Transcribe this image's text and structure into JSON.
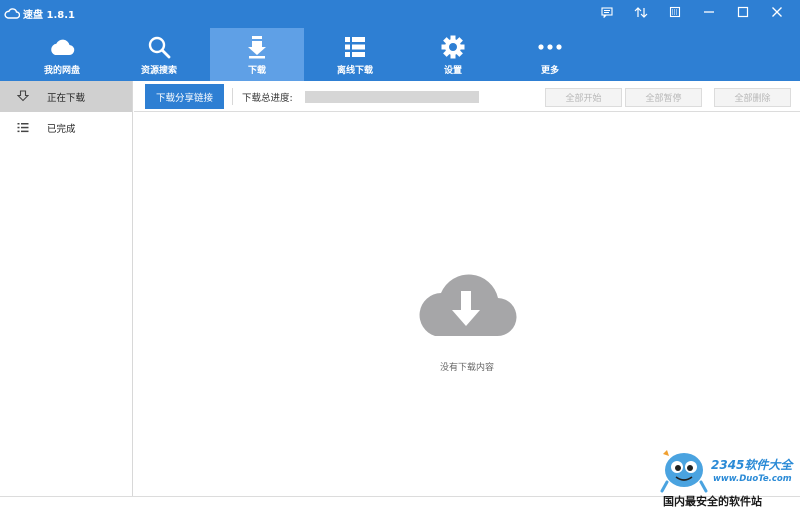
{
  "window": {
    "title": "速盘 1.8.1",
    "controls": [
      "message-icon",
      "sync-icon",
      "skin-icon",
      "minimize-icon",
      "maximize-icon",
      "close-icon"
    ]
  },
  "nav": {
    "items": [
      {
        "label": "我的网盘",
        "icon": "cloud-icon"
      },
      {
        "label": "资源搜索",
        "icon": "search-icon"
      },
      {
        "label": "下载",
        "icon": "download-icon",
        "active": true
      },
      {
        "label": "离线下载",
        "icon": "list-icon"
      },
      {
        "label": "设置",
        "icon": "gear-icon"
      },
      {
        "label": "更多",
        "icon": "more-icon"
      }
    ]
  },
  "sidebar": {
    "items": [
      {
        "label": "正在下载",
        "icon": "download-arrow-icon",
        "active": true
      },
      {
        "label": "已完成",
        "icon": "completed-list-icon"
      }
    ]
  },
  "toolbar": {
    "share_label": "下载分享链接",
    "progress_label": "下载总进度:",
    "progress_value": 0,
    "start_all_label": "全部开始",
    "pause_all_label": "全部暂停",
    "delete_all_label": "全部删除"
  },
  "content": {
    "empty_text": "没有下载内容"
  },
  "watermark": {
    "brand": "2345软件大全",
    "url": "www.DuoTe.com",
    "tagline": "国内最安全的软件站"
  },
  "colors": {
    "primary": "#2e7fd3",
    "nav_active": "#5fa0e6",
    "sidebar_active": "#d0d0d0",
    "empty_icon": "#a6a6a8"
  }
}
